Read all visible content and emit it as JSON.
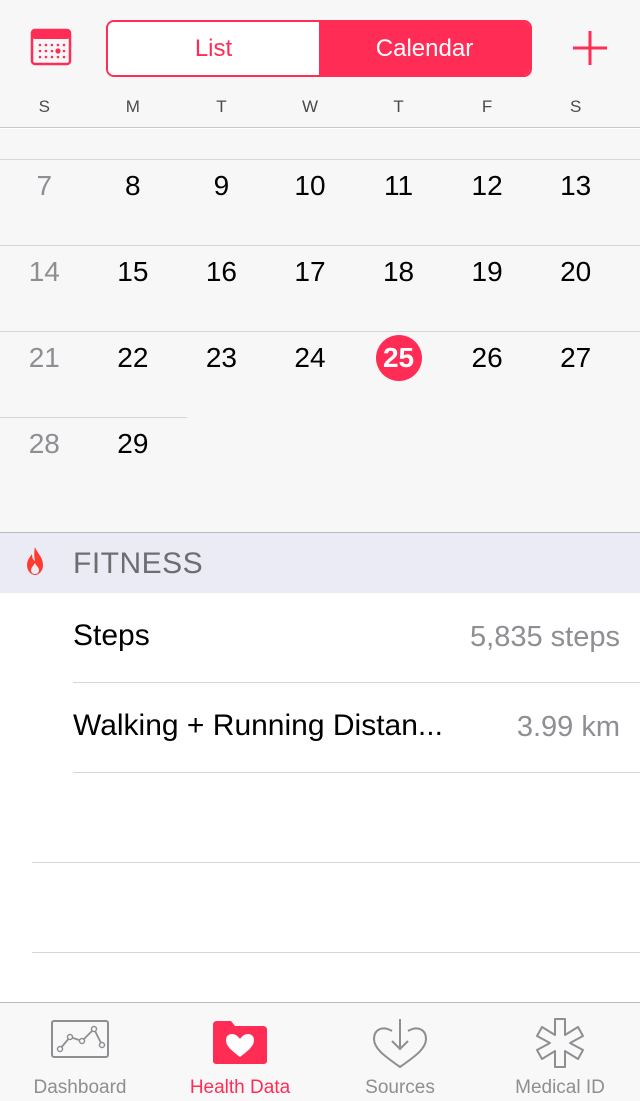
{
  "header": {
    "segments": [
      "List",
      "Calendar"
    ],
    "active_segment": "Calendar"
  },
  "weekdays": [
    "S",
    "M",
    "T",
    "W",
    "T",
    "F",
    "S"
  ],
  "calendar": {
    "rows": [
      [
        "7",
        "8",
        "9",
        "10",
        "11",
        "12",
        "13"
      ],
      [
        "14",
        "15",
        "16",
        "17",
        "18",
        "19",
        "20"
      ],
      [
        "21",
        "22",
        "23",
        "24",
        "25",
        "26",
        "27"
      ],
      [
        "28",
        "29"
      ]
    ],
    "today": "25"
  },
  "section": {
    "title": "FITNESS",
    "icon": "flame-icon"
  },
  "items": [
    {
      "label": "Steps",
      "value": "5,835 steps"
    },
    {
      "label": "Walking + Running Distan...",
      "value": "3.99 km"
    }
  ],
  "tabs": [
    {
      "label": "Dashboard",
      "icon": "dashboard-icon"
    },
    {
      "label": "Health Data",
      "icon": "health-data-icon"
    },
    {
      "label": "Sources",
      "icon": "sources-icon"
    },
    {
      "label": "Medical ID",
      "icon": "medical-id-icon"
    }
  ],
  "colors": {
    "accent": "#ff2d55",
    "secondary_text": "#8e8e93",
    "section_bg": "#ebebf5"
  }
}
